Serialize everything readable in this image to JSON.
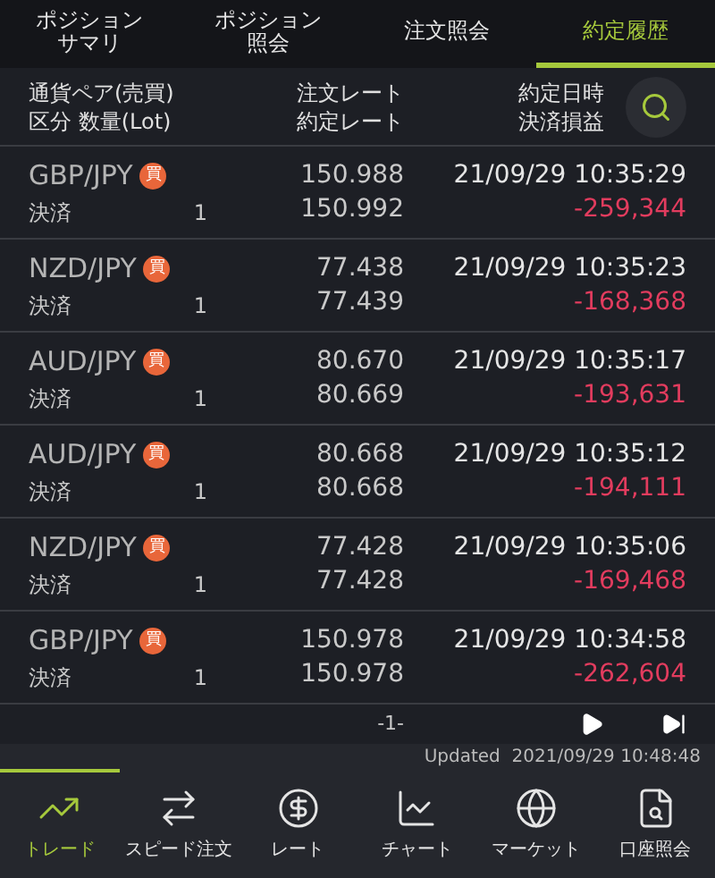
{
  "tabs": [
    {
      "label": "ポジションサマリ",
      "selected": false
    },
    {
      "label": "ポジション照会",
      "selected": false
    },
    {
      "label": "注文照会",
      "selected": false
    },
    {
      "label": "約定履歴",
      "selected": true
    }
  ],
  "header": {
    "col_1": [
      "通貨ペア(売買)",
      "区分 数量(Lot)"
    ],
    "col_2": [
      "注文レート",
      "約定レート"
    ],
    "col_3": [
      "約定日時",
      "決済損益"
    ]
  },
  "rows": [
    {
      "pair": "GBP/JPY",
      "side": "買",
      "type": "決済",
      "lots": "1",
      "order_rate": "150.988",
      "fill_rate": "150.992",
      "time": "21/09/29 10:35:29",
      "pl": "-259,344"
    },
    {
      "pair": "NZD/JPY",
      "side": "買",
      "type": "決済",
      "lots": "1",
      "order_rate": "77.438",
      "fill_rate": "77.439",
      "time": "21/09/29 10:35:23",
      "pl": "-168,368"
    },
    {
      "pair": "AUD/JPY",
      "side": "買",
      "type": "決済",
      "lots": "1",
      "order_rate": "80.670",
      "fill_rate": "80.669",
      "time": "21/09/29 10:35:17",
      "pl": "-193,631"
    },
    {
      "pair": "AUD/JPY",
      "side": "買",
      "type": "決済",
      "lots": "1",
      "order_rate": "80.668",
      "fill_rate": "80.668",
      "time": "21/09/29 10:35:12",
      "pl": "-194,111"
    },
    {
      "pair": "NZD/JPY",
      "side": "買",
      "type": "決済",
      "lots": "1",
      "order_rate": "77.428",
      "fill_rate": "77.428",
      "time": "21/09/29 10:35:06",
      "pl": "-169,468"
    },
    {
      "pair": "GBP/JPY",
      "side": "買",
      "type": "決済",
      "lots": "1",
      "order_rate": "150.978",
      "fill_rate": "150.978",
      "time": "21/09/29 10:34:58",
      "pl": "-262,604"
    }
  ],
  "pager": {
    "page": "-1-"
  },
  "updated": "Updated  2021/09/29 10:48:48",
  "nav": [
    {
      "kind": "trade",
      "label": "トレード",
      "selected": true
    },
    {
      "kind": "speed",
      "label": "スピード注文",
      "selected": false
    },
    {
      "kind": "rate",
      "label": "レート",
      "selected": false
    },
    {
      "kind": "chart",
      "label": "チャート",
      "selected": false
    },
    {
      "kind": "market",
      "label": "マーケット",
      "selected": false
    },
    {
      "kind": "account",
      "label": "口座照会",
      "selected": false
    }
  ]
}
